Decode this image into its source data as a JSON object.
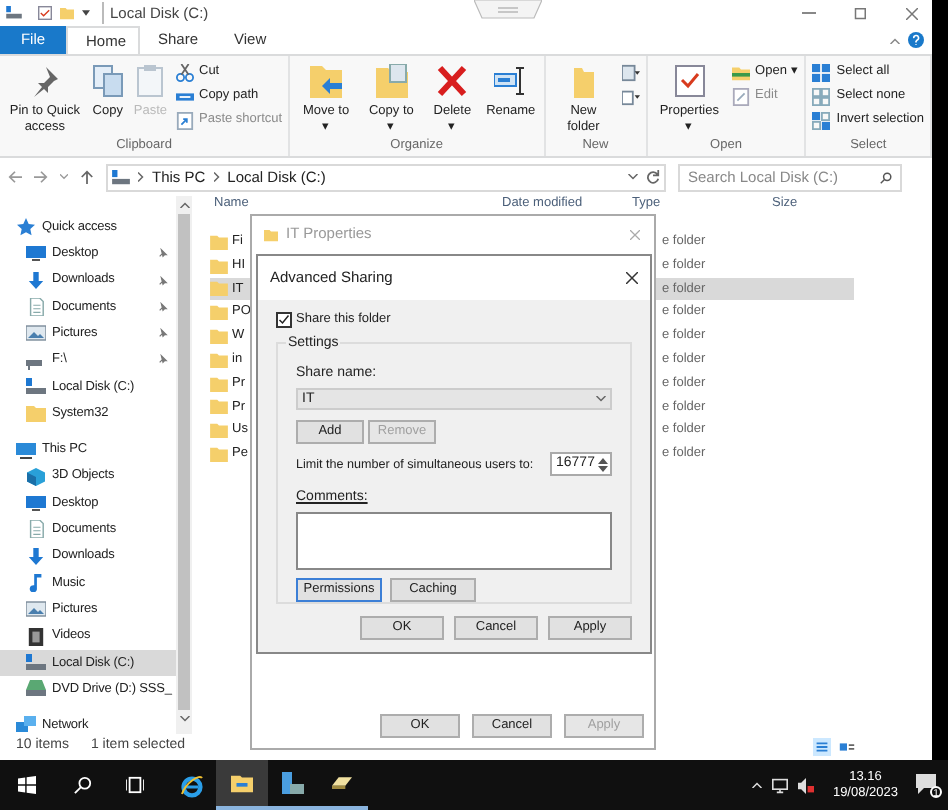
{
  "window": {
    "title": "Local Disk (C:)"
  },
  "ribbon": {
    "tabs": [
      {
        "label": "File",
        "kind": "file",
        "selected": false
      },
      {
        "label": "Home",
        "kind": "tab",
        "selected": true
      },
      {
        "label": "Share",
        "kind": "tab",
        "selected": false
      },
      {
        "label": "View",
        "kind": "tab",
        "selected": false
      }
    ],
    "groups": [
      {
        "label": "Clipboard",
        "columns": [
          [
            {
              "label": "Pin to Quick access",
              "kind": "pin",
              "disabled": false
            }
          ],
          [
            {
              "label": "Copy",
              "kind": "copy",
              "disabled": false
            }
          ],
          [
            {
              "label": "Paste",
              "kind": "paste",
              "disabled": true
            }
          ],
          [
            {
              "label": "Cut",
              "kind": "cut",
              "disabled": false
            },
            {
              "label": "Copy path",
              "kind": "copypath",
              "disabled": false
            },
            {
              "label": "Paste shortcut",
              "kind": "pasteshortcut",
              "disabled": true
            }
          ]
        ]
      },
      {
        "label": "Organize",
        "columns": [
          [
            {
              "label": "Move to ▾",
              "kind": "moveto",
              "disabled": false
            }
          ],
          [
            {
              "label": "Copy to ▾",
              "kind": "copyto",
              "disabled": false
            }
          ],
          [
            {
              "label": "Delete ▾",
              "kind": "delete",
              "disabled": false
            }
          ],
          [
            {
              "label": "Rename",
              "kind": "rename",
              "disabled": false
            }
          ]
        ]
      },
      {
        "label": "New",
        "columns": [
          [
            {
              "label": "New folder",
              "kind": "newfolder",
              "disabled": false
            }
          ],
          [
            {
              "kind": "newitem",
              "disabled": false
            },
            {
              "kind": "easyaccess",
              "disabled": false
            }
          ]
        ]
      },
      {
        "label": "Open",
        "columns": [
          [
            {
              "label": "Properties ▾",
              "kind": "properties",
              "disabled": false
            }
          ],
          [
            {
              "label": "Open ▾",
              "kind": "open",
              "disabled": false
            },
            {
              "label": "Edit",
              "kind": "edit",
              "disabled": true
            }
          ]
        ]
      },
      {
        "label": "Select",
        "columns": [
          [
            {
              "label": "Select all",
              "kind": "selectall",
              "disabled": false
            },
            {
              "label": "Select none",
              "kind": "selectnone",
              "disabled": false
            },
            {
              "label": "Invert selection",
              "kind": "invert",
              "disabled": false
            }
          ]
        ]
      }
    ]
  },
  "address": {
    "path": [
      "This PC",
      "Local Disk (C:)"
    ],
    "search": {
      "placeholder": "Search Local Disk (C:)"
    }
  },
  "sidebar": {
    "items": [
      {
        "label": "Quick access",
        "kind": "star",
        "selected": false,
        "children": [
          {
            "label": "Desktop",
            "kind": "desktop",
            "pinned": true,
            "selected": false
          },
          {
            "label": "Downloads",
            "kind": "downloads",
            "pinned": true,
            "selected": false
          },
          {
            "label": "Documents",
            "kind": "documents",
            "pinned": true,
            "selected": false
          },
          {
            "label": "Pictures",
            "kind": "pictures",
            "pinned": true,
            "selected": false
          },
          {
            "label": "F:\\",
            "kind": "netdrive",
            "pinned": true,
            "selected": false
          },
          {
            "label": "Local Disk (C:)",
            "kind": "drive",
            "pinned": false,
            "selected": false
          },
          {
            "label": "System32",
            "kind": "folder",
            "pinned": false,
            "selected": false
          }
        ]
      },
      {
        "label": "This PC",
        "kind": "pc",
        "selected": false,
        "children": [
          {
            "label": "3D Objects",
            "kind": "objects",
            "pinned": false,
            "selected": false
          },
          {
            "label": "Desktop",
            "kind": "desktop",
            "pinned": false,
            "selected": false
          },
          {
            "label": "Documents",
            "kind": "documents",
            "pinned": false,
            "selected": false
          },
          {
            "label": "Downloads",
            "kind": "downloads",
            "pinned": false,
            "selected": false
          },
          {
            "label": "Music",
            "kind": "music",
            "pinned": false,
            "selected": false
          },
          {
            "label": "Pictures",
            "kind": "pictures",
            "pinned": false,
            "selected": false
          },
          {
            "label": "Videos",
            "kind": "videos",
            "pinned": false,
            "selected": false
          },
          {
            "label": "Local Disk (C:)",
            "kind": "drive",
            "pinned": false,
            "selected": true
          },
          {
            "label": "DVD Drive (D:) SSS_",
            "kind": "dvd",
            "pinned": false,
            "selected": false
          }
        ]
      },
      {
        "label": "Network",
        "kind": "network",
        "selected": false
      }
    ]
  },
  "files": {
    "columns": [
      "Name",
      "Date modified",
      "Type",
      "Size"
    ],
    "rows": [
      {
        "name": "Fi",
        "type": "e folder",
        "selected": false
      },
      {
        "name": "HI",
        "type": "e folder",
        "selected": false
      },
      {
        "name": "IT",
        "type": "e folder",
        "selected": true
      },
      {
        "name": "PO",
        "type": "e folder",
        "selected": false
      },
      {
        "name": "W",
        "type": "e folder",
        "selected": false
      },
      {
        "name": "in",
        "type": "e folder",
        "selected": false
      },
      {
        "name": "Pr",
        "type": "e folder",
        "selected": false
      },
      {
        "name": "Pr",
        "type": "e folder",
        "selected": false
      },
      {
        "name": "Us",
        "type": "e folder",
        "selected": false
      },
      {
        "name": "Pe",
        "type": "e folder",
        "selected": false
      }
    ]
  },
  "status_bar": {
    "count": "10 items",
    "selection": "1 item selected"
  },
  "properties_dialog": {
    "title": "IT Properties",
    "buttons": [
      {
        "label": "OK",
        "disabled": false
      },
      {
        "label": "Cancel",
        "disabled": false
      },
      {
        "label": "Apply",
        "disabled": true
      }
    ]
  },
  "sharing_dialog": {
    "title": "Advanced Sharing",
    "share": {
      "label": "Share this folder",
      "checked": true
    },
    "settings_label": "Settings",
    "share_name_label": "Share name:",
    "share_name": "IT",
    "name_buttons": [
      {
        "label": "Add",
        "disabled": false
      },
      {
        "label": "Remove",
        "disabled": true
      }
    ],
    "limit_label": "Limit the number of simultaneous users to:",
    "limit": "16777",
    "comments_label": "Comments:",
    "action_buttons": [
      {
        "label": "Permissions",
        "focused": true
      },
      {
        "label": "Caching",
        "focused": false
      }
    ],
    "buttons": [
      {
        "label": "OK",
        "disabled": false
      },
      {
        "label": "Cancel",
        "disabled": false
      },
      {
        "label": "Apply",
        "disabled": false
      }
    ]
  },
  "taskbar": {
    "apps": [
      {
        "kind": "ie",
        "running": false,
        "active": false
      },
      {
        "kind": "explorer",
        "running": true,
        "active": true
      },
      {
        "kind": "server",
        "running": true,
        "active": false
      },
      {
        "kind": "drive",
        "running": true,
        "active": false
      }
    ],
    "time": "13.16",
    "date": "19/08/2023",
    "notifications": "1"
  }
}
